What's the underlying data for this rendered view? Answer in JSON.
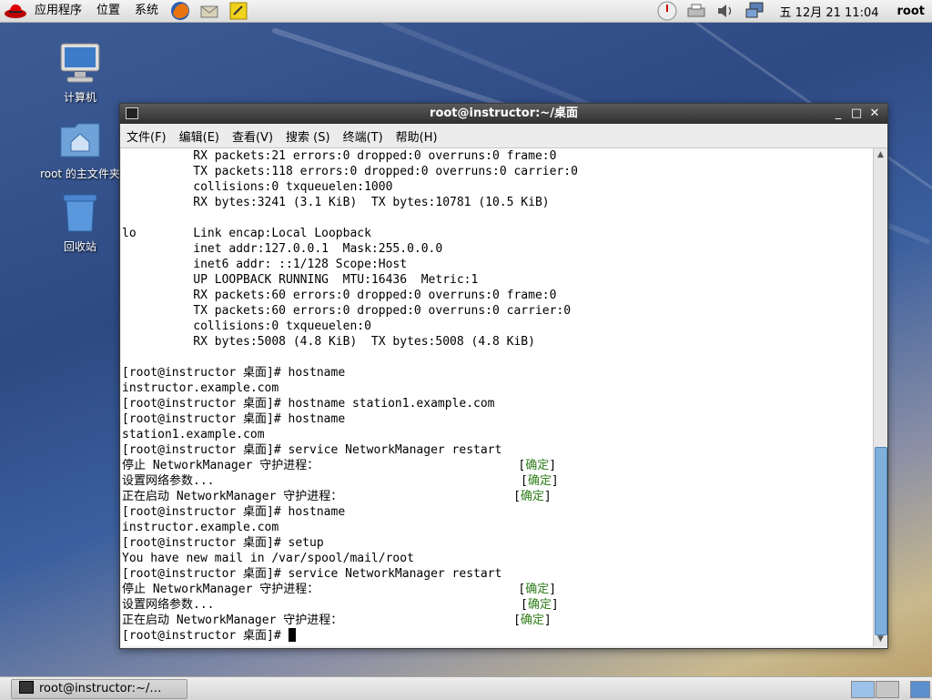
{
  "top_panel": {
    "menus": [
      "应用程序",
      "位置",
      "系统"
    ],
    "clock": "五 12月 21 11:04",
    "user": "root"
  },
  "desktop": {
    "icons": [
      {
        "label": "计算机",
        "icon": "computer-icon"
      },
      {
        "label": "root 的主文件夹",
        "icon": "home-folder-icon"
      },
      {
        "label": "回收站",
        "icon": "trash-icon"
      }
    ]
  },
  "window": {
    "title": "root@instructor:~/桌面",
    "menu": [
      "文件(F)",
      "编辑(E)",
      "查看(V)",
      "搜索 (S)",
      "终端(T)",
      "帮助(H)"
    ]
  },
  "terminal": {
    "lines": [
      "          RX packets:21 errors:0 dropped:0 overruns:0 frame:0",
      "          TX packets:118 errors:0 dropped:0 overruns:0 carrier:0",
      "          collisions:0 txqueuelen:1000",
      "          RX bytes:3241 (3.1 KiB)  TX bytes:10781 (10.5 KiB)",
      "",
      "lo        Link encap:Local Loopback",
      "          inet addr:127.0.0.1  Mask:255.0.0.0",
      "          inet6 addr: ::1/128 Scope:Host",
      "          UP LOOPBACK RUNNING  MTU:16436  Metric:1",
      "          RX packets:60 errors:0 dropped:0 overruns:0 frame:0",
      "          TX packets:60 errors:0 dropped:0 overruns:0 carrier:0",
      "          collisions:0 txqueuelen:0",
      "          RX bytes:5008 (4.8 KiB)  TX bytes:5008 (4.8 KiB)",
      "",
      "[root@instructor 桌面]# hostname",
      "instructor.example.com",
      "[root@instructor 桌面]# hostname station1.example.com",
      "[root@instructor 桌面]# hostname",
      "station1.example.com",
      "[root@instructor 桌面]# service NetworkManager restart",
      "停止 NetworkManager 守护进程：                            [确定]",
      "设置网络参数...                                           [确定]",
      "正在启动 NetworkManager 守护进程：                        [确定]",
      "[root@instructor 桌面]# hostname",
      "instructor.example.com",
      "[root@instructor 桌面]# setup",
      "You have new mail in /var/spool/mail/root",
      "[root@instructor 桌面]# service NetworkManager restart",
      "停止 NetworkManager 守护进程：                            [确定]",
      "设置网络参数...                                           [确定]",
      "正在启动 NetworkManager 守护进程：                        [确定]"
    ],
    "prompt": "[root@instructor 桌面]# ",
    "ok_color": "#2e7d19"
  },
  "taskbar": {
    "task_label": "root@instructor:~/…"
  }
}
